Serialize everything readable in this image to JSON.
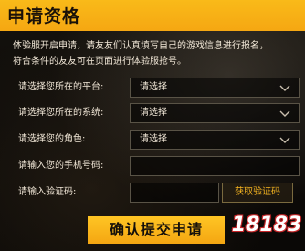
{
  "header": {
    "title": "申请资格"
  },
  "intro": {
    "line1": "体验服开启申请，请友友们认真填写自己的游戏信息进行报名，",
    "line2": "符合条件的友友可在页面进行体验服抢号。"
  },
  "form": {
    "platform": {
      "label": "请选择您所在的平台:",
      "value": "请选择"
    },
    "system": {
      "label": "请选择您所在的系统:",
      "value": "请选择"
    },
    "role": {
      "label": "请选择您的角色:",
      "value": "请选择"
    },
    "phone": {
      "label": "请输入您的手机号码:",
      "value": ""
    },
    "code": {
      "label": "请输入验证码:",
      "value": "",
      "button": "获取验证码"
    }
  },
  "submit": {
    "label": "确认提交申请"
  },
  "watermark": {
    "text": "18183"
  },
  "colors": {
    "accent": "#f5a712",
    "text": "#f0e6d6",
    "border": "#595346"
  }
}
